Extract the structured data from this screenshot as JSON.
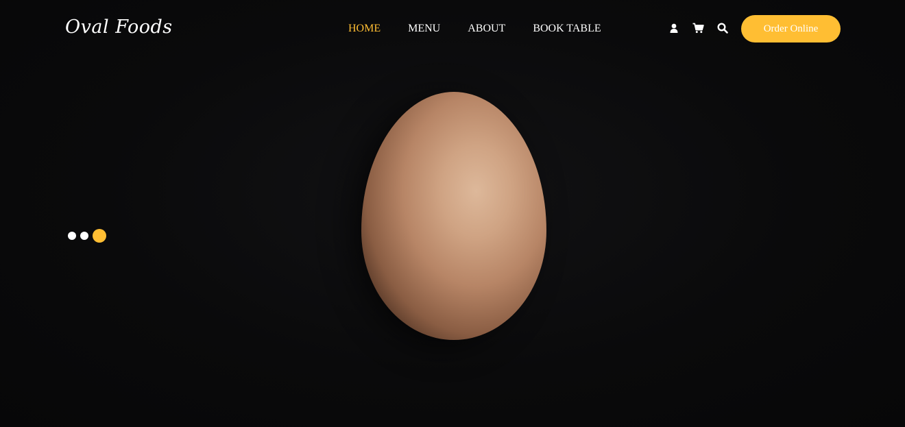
{
  "brand": {
    "name": "Oval Foods"
  },
  "nav": {
    "items": [
      {
        "label": "HOME",
        "active": true
      },
      {
        "label": "MENU",
        "active": false
      },
      {
        "label": "ABOUT",
        "active": false
      },
      {
        "label": "BOOK TABLE",
        "active": false
      }
    ]
  },
  "actions": {
    "icons": [
      "user-icon",
      "cart-icon",
      "search-icon"
    ],
    "order_button_label": "Order Online"
  },
  "slider": {
    "dot_count": 3,
    "active_index": 2
  },
  "colors": {
    "accent": "#ffbe33",
    "background": "#0b0b0c",
    "text": "#ffffff"
  }
}
